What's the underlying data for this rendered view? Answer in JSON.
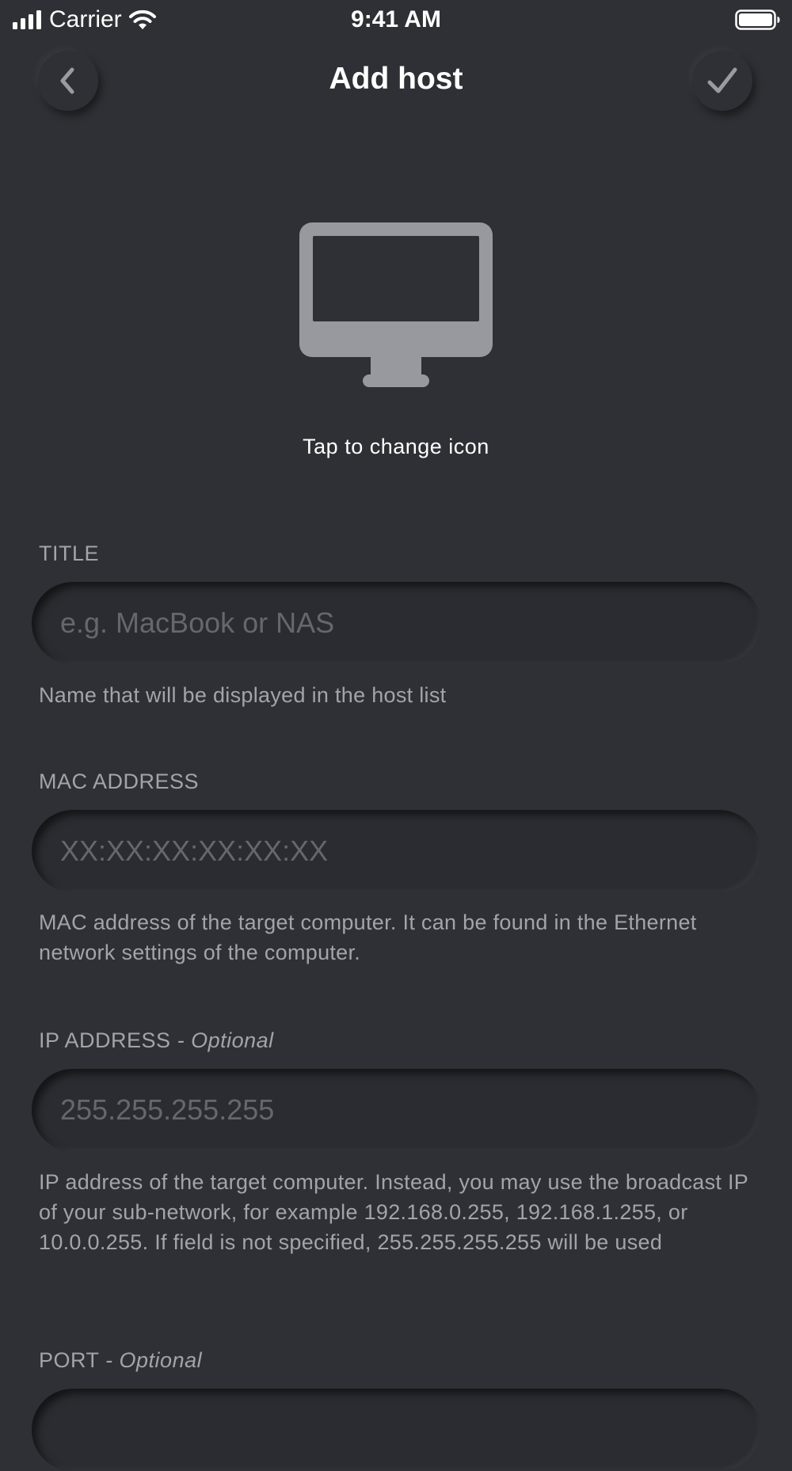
{
  "status_bar": {
    "carrier": "Carrier",
    "time": "9:41 AM"
  },
  "header": {
    "title": "Add host",
    "back_icon": "chevron-left-icon",
    "done_icon": "checkmark-icon"
  },
  "icon_picker": {
    "icon": "desktop-monitor-icon",
    "label": "Tap to change icon"
  },
  "form": {
    "title": {
      "label": "TITLE",
      "placeholder": "e.g. MacBook or NAS",
      "hint": "Name that will be displayed in the host list"
    },
    "mac": {
      "label": "MAC ADDRESS",
      "placeholder": "XX:XX:XX:XX:XX:XX",
      "hint": "MAC address of the target computer. It can be found in the Ethernet network settings of the computer."
    },
    "ip": {
      "label": "IP ADDRESS",
      "optional": "- Optional",
      "placeholder": "255.255.255.255",
      "hint": "IP address of the target computer. Instead, you may use the broadcast IP of your sub-network, for example 192.168.0.255, 192.168.1.255, or 10.0.0.255. If field is not specified, 255.255.255.255 will be used"
    },
    "port": {
      "label": "PORT",
      "optional": "- Optional"
    }
  },
  "colors": {
    "background": "#2f3035",
    "field": "#2b2c31",
    "secondary_text": "#a3a4aa",
    "placeholder": "#66676d",
    "icon": "#98999e"
  }
}
